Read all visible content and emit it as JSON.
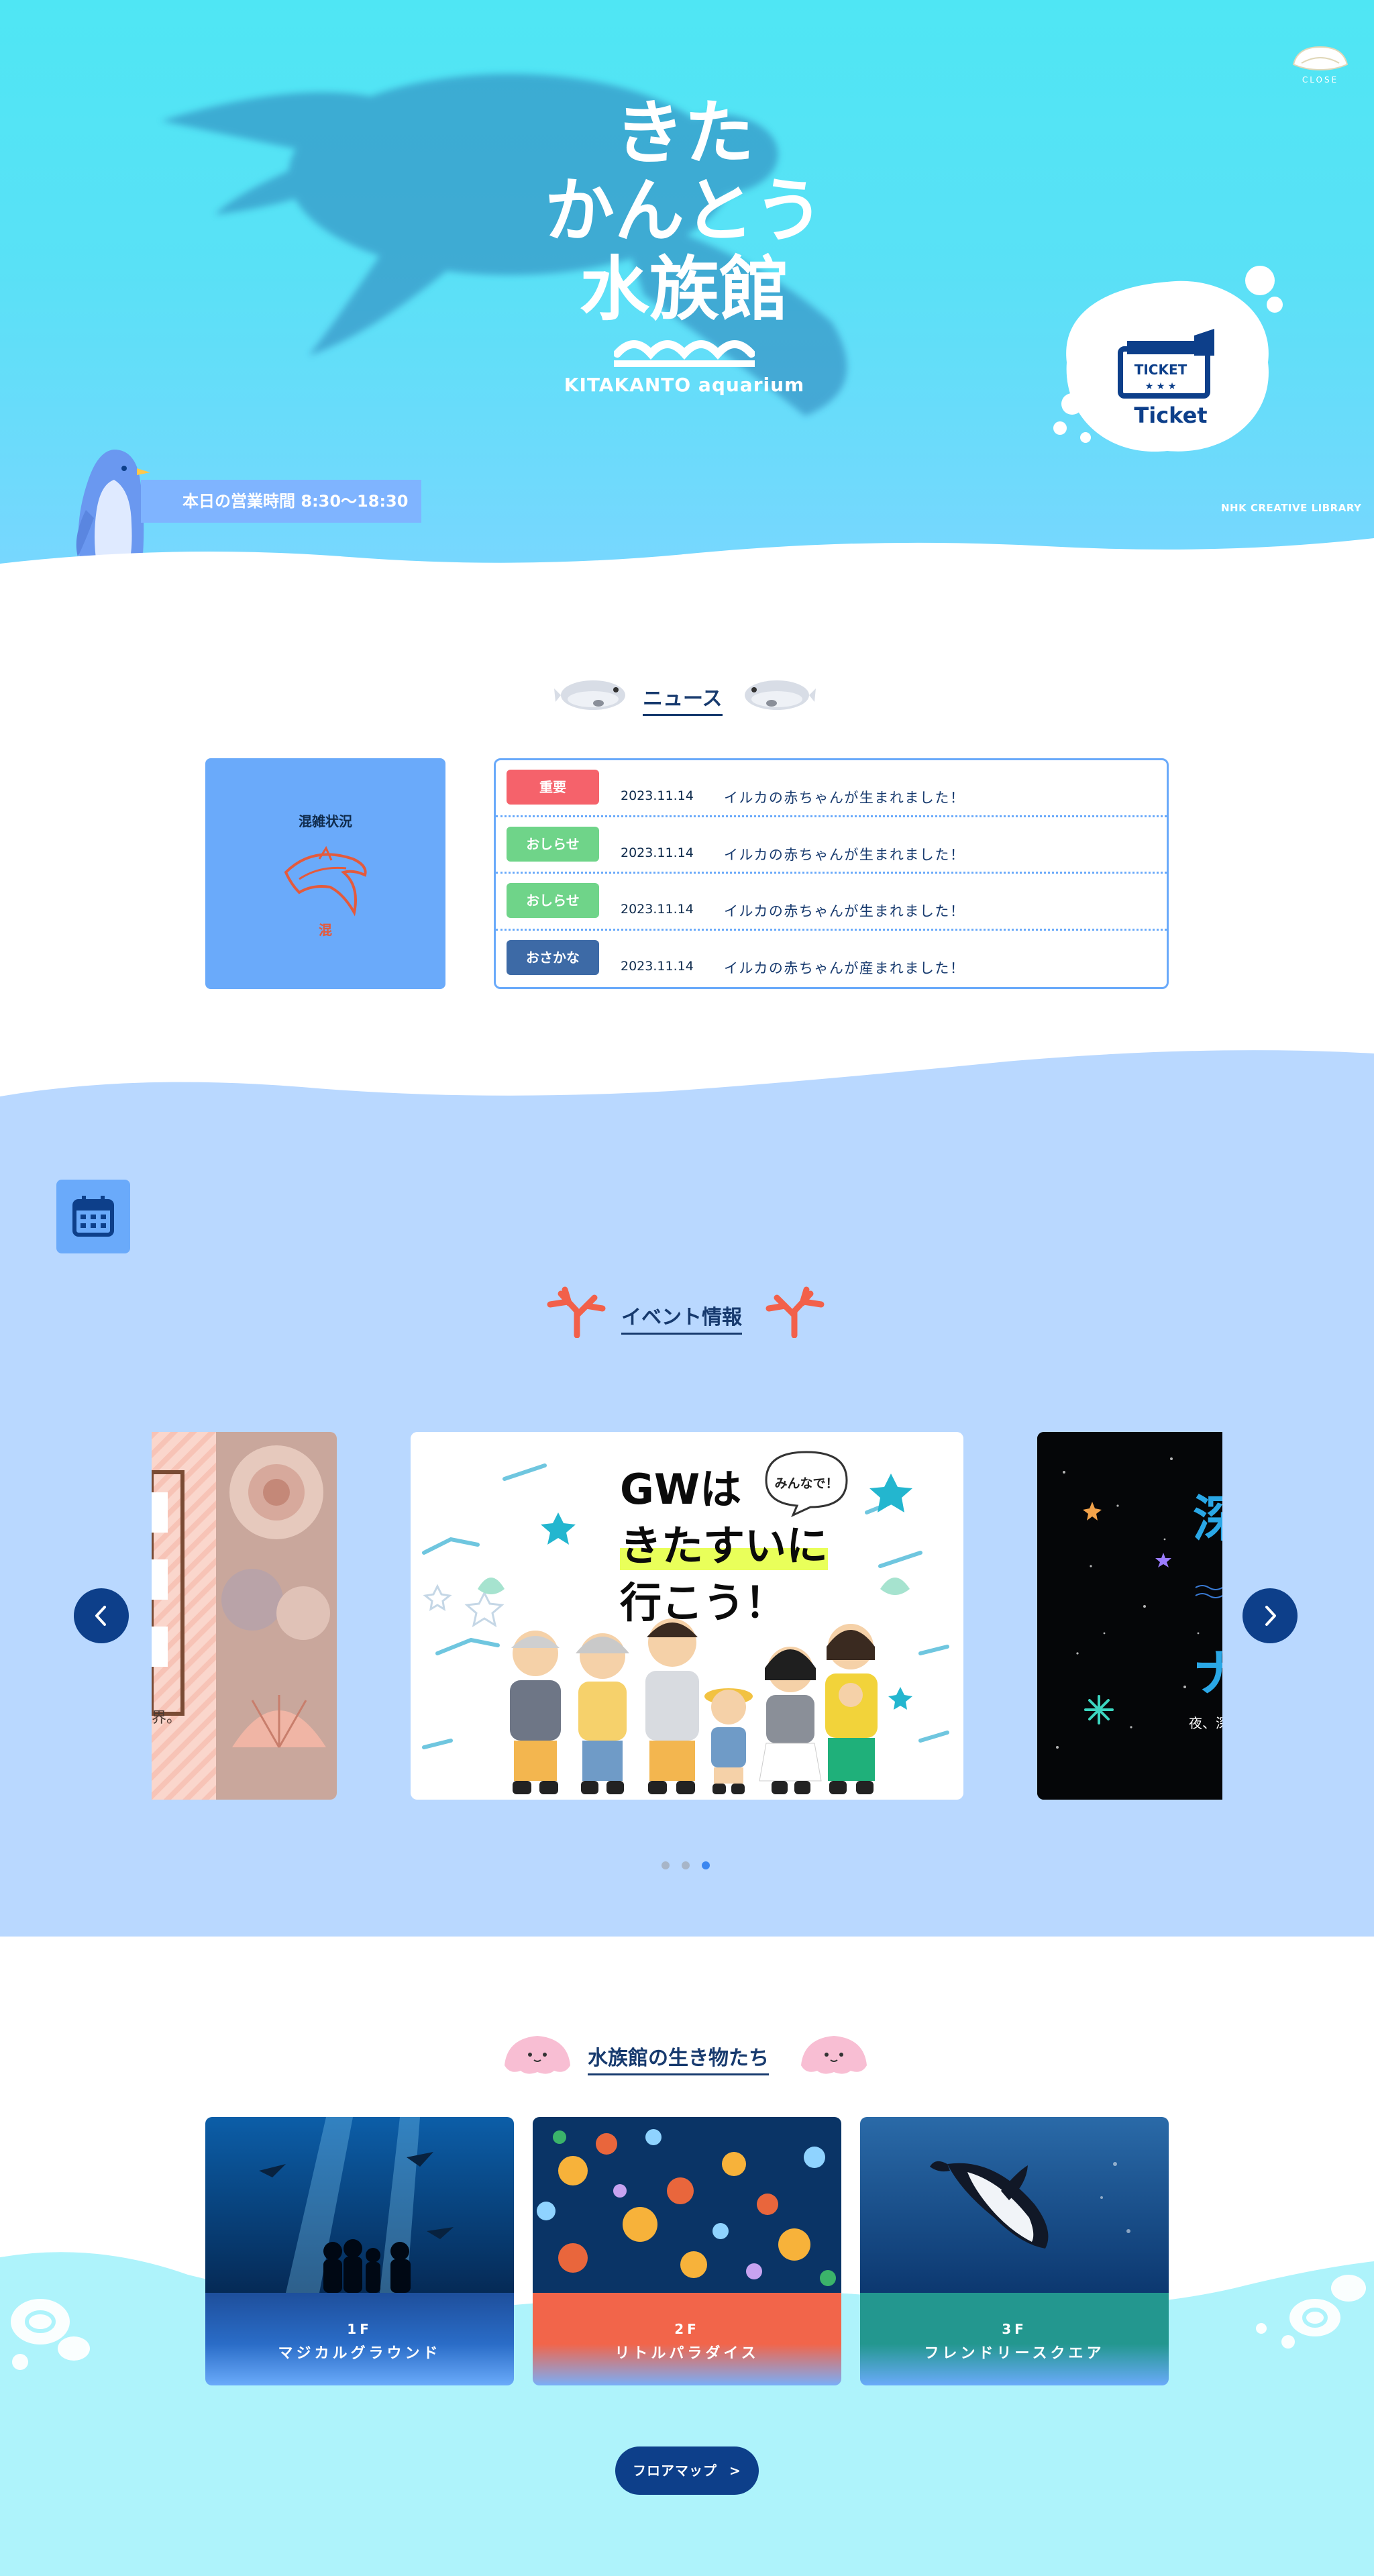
{
  "hero": {
    "logo_line1": "きた",
    "logo_line2": "かんとう",
    "logo_line3": "水族館",
    "logo_en": "KITAKANTO aquarium",
    "close_label": "CLOSE",
    "ticket_label": "Ticket",
    "ticket_stamp": "TICKET",
    "hours": "本日の営業時間 8:30〜18:30",
    "credit": "NHK CREATIVE LIBRARY"
  },
  "news": {
    "title": "ニュース",
    "congestion_title": "混雑状況",
    "congestion_level": "混",
    "items": [
      {
        "badge": "重要",
        "badge_color": "#f5626b",
        "date": "2023.11.14",
        "text": "イルカの赤ちゃんが生まれました！"
      },
      {
        "badge": "おしらせ",
        "badge_color": "#6fd489",
        "date": "2023.11.14",
        "text": "イルカの赤ちゃんが生まれました！"
      },
      {
        "badge": "おしらせ",
        "badge_color": "#6fd489",
        "date": "2023.11.14",
        "text": "イルカの赤ちゃんが生まれました！"
      },
      {
        "badge": "おさかな",
        "badge_color": "#3d6aa6",
        "date": "2023.11.14",
        "text": "イルカの赤ちゃんが産まれました！"
      }
    ]
  },
  "events": {
    "title": "イベント情報",
    "calendar_icon": "calendar-icon",
    "slide_main_line1": "GWは",
    "slide_main_line2": "きたすいに",
    "slide_main_line3": "行こう！",
    "slide_main_bubble": "みんなで！",
    "slide_left_caption": "界。",
    "slide_right_char1": "深",
    "slide_right_char2": "ナ",
    "slide_right_caption": "夜、深",
    "active_dot": 2,
    "dot_count": 3
  },
  "creatures": {
    "title": "水族館の生き物たち",
    "cards": [
      {
        "floor": "1F",
        "zone": "マジカルグラウンド",
        "color": "#1e4f9c"
      },
      {
        "floor": "2F",
        "zone": "リトルパラダイス",
        "color": "#f2654a"
      },
      {
        "floor": "3F",
        "zone": "フレンドリースクエア",
        "color": "#23978f"
      }
    ],
    "floor_map_button": "フロアマップ"
  },
  "colors": {
    "accent_blue": "#6aaafa",
    "navy": "#0d3f8a",
    "hero_cyan": "#52e3f5",
    "events_bg": "#b9d8ff",
    "creatures_bg": "#aef3fb"
  }
}
